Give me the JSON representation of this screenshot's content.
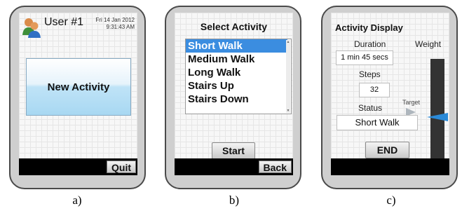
{
  "screen_a": {
    "user": "User #1",
    "date": "Fri 14 Jan 2012",
    "time": "9:31:43 AM",
    "new_activity_label": "New Activity",
    "quit_label": "Quit",
    "icon": "user-avatar-icon"
  },
  "screen_b": {
    "title": "Select Activity",
    "activities": [
      "Short Walk",
      "Medium Walk",
      "Long Walk",
      "Stairs Up",
      "Stairs Down"
    ],
    "selected": "Short Walk",
    "start_label": "Start",
    "back_label": "Back"
  },
  "screen_c": {
    "title": "Activity Display",
    "duration_label": "Duration",
    "duration_value": "1 min 45 secs",
    "weight_label": "Weight",
    "steps_label": "Steps",
    "steps_value": "32",
    "target_label": "Target",
    "status_label": "Status",
    "status_value": "Short Walk",
    "end_label": "END"
  },
  "captions": [
    "a)",
    "b)",
    "c)"
  ],
  "colors": {
    "selection": "#3b8de0",
    "new_activity_button": "#bfe3f7",
    "weight_marker": "#2a8ad8",
    "target_marker": "#aeb6bd",
    "bottom_bar": "#000000"
  }
}
